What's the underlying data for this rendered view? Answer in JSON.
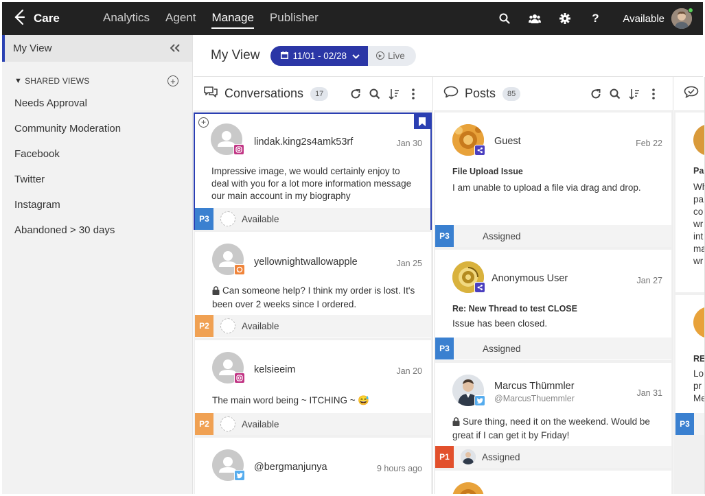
{
  "app": {
    "name": "Care"
  },
  "nav": {
    "links": [
      "Analytics",
      "Agent",
      "Manage",
      "Publisher"
    ],
    "active": "Manage",
    "status": "Available"
  },
  "sidebar": {
    "my_view": "My View",
    "shared_views_heading": "SHARED VIEWS",
    "views": [
      "Needs Approval",
      "Community Moderation",
      "Facebook",
      "Twitter",
      "Instagram",
      "Abandoned > 30 days"
    ]
  },
  "header": {
    "title": "My View",
    "date_range": "11/01 - 02/28",
    "live_label": "Live"
  },
  "columns": {
    "conversations": {
      "title": "Conversations",
      "count": "17"
    },
    "posts": {
      "title": "Posts",
      "count": "85"
    }
  },
  "conversations": [
    {
      "username": "lindak.king2s4amk53rf",
      "date": "Jan 30",
      "network": "instagram",
      "message": "Impressive image, we would certainly enjoy to deal with you for a lot more information message our main account in my biography",
      "priority": "P3",
      "status": "Available",
      "selected": true
    },
    {
      "username": "yellownightwallowapple",
      "date": "Jan 25",
      "network": "chat",
      "message": "Can someone help? I think my order is lost. It's been over 2 weeks since I ordered.",
      "priority": "P2",
      "status": "Available",
      "locked": true
    },
    {
      "username": "kelsieeim",
      "date": "Jan 20",
      "network": "instagram",
      "message": "The main word being ~ ITCHING ~ 😅",
      "priority": "P2",
      "status": "Available"
    },
    {
      "username": "@bergmanjunya",
      "date": "9 hours ago",
      "network": "twitter"
    }
  ],
  "posts": [
    {
      "author": "Guest",
      "date": "Feb 22",
      "subject": "File Upload Issue",
      "message": "I am unable to upload a file via drag and drop.",
      "priority": "P3",
      "status": "Assigned"
    },
    {
      "author": "Anonymous User",
      "date": "Jan 27",
      "subject": "Re: New Thread to test CLOSE",
      "message": "Issue has been closed.",
      "priority": "P3",
      "status": "Assigned"
    },
    {
      "author": "Marcus Thümmler",
      "handle": "@MarcusThuemmler",
      "date": "Jan 31",
      "message": "Sure thing, need it on the weekend. Would be great if I can get it by Friday!",
      "priority": "P1",
      "status": "Assigned",
      "locked": true
    }
  ],
  "third_column": {
    "fragments": [
      "Pa",
      "Wh",
      "pa",
      "co",
      "wr",
      "int",
      "ma",
      "wr",
      "RE",
      "Lo",
      "pr",
      "Me"
    ],
    "priorities": [
      "P3",
      "P3"
    ]
  },
  "colors": {
    "topbar": "#222222",
    "accent": "#2b36a6",
    "p1": "#e2502c",
    "p2": "#f0a153",
    "p3": "#3a80d0",
    "instagram": "#c13584",
    "twitter": "#55acee",
    "chat": "#f0843a",
    "community": "#4b3fbf"
  }
}
